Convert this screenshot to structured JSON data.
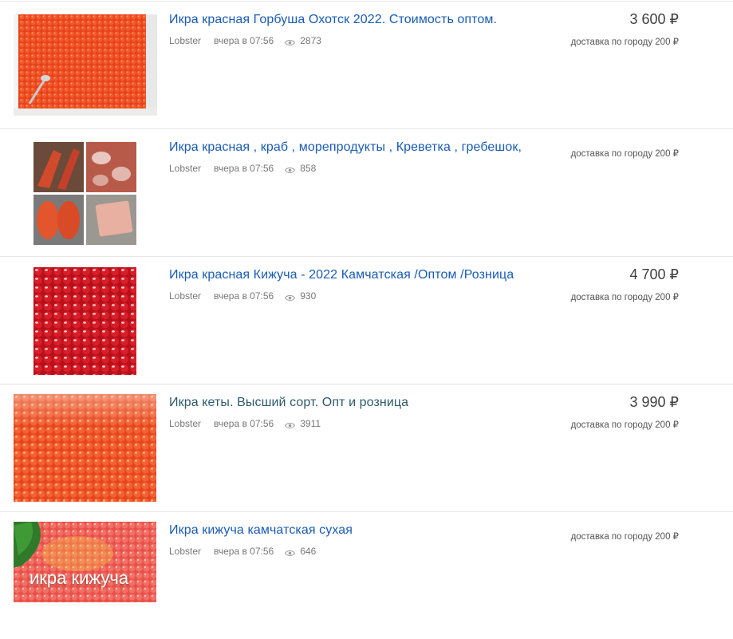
{
  "listings": [
    {
      "title": "Икра красная Горбуша Охотск 2022. Стоимость оптом.",
      "seller": "Lobster",
      "time": "вчера в 07:56",
      "views": "2873",
      "price": "3 600 ₽",
      "delivery": "доставка по городу 200 ₽",
      "image": "red-caviar-tray-photo"
    },
    {
      "title": "Икра красная , краб , морепродукты , Креветка , гребешок,",
      "seller": "Lobster",
      "time": "вчера в 07:56",
      "views": "858",
      "price": "",
      "delivery": "доставка по городу 200 ₽",
      "image": "seafood-collage-photo"
    },
    {
      "title": "Икра красная Кижуча - 2022 Камчатская /Оптом /Розница",
      "seller": "Lobster",
      "time": "вчера в 07:56",
      "views": "930",
      "price": "4 700 ₽",
      "delivery": "доставка по городу 200 ₽",
      "image": "coho-caviar-closeup-photo"
    },
    {
      "title": "Икра кеты. Высший сорт. Опт и розница",
      "seller": "Lobster",
      "time": "вчера в 07:56",
      "views": "3911",
      "price": "3 990 ₽",
      "delivery": "доставка по городу 200 ₽",
      "image": "chum-caviar-closeup-photo"
    },
    {
      "title": "Икра кижуча камчатская сухая",
      "seller": "Lobster",
      "time": "вчера в 07:56",
      "views": "646",
      "price": "",
      "delivery": "доставка по городу 200 ₽",
      "image": "coho-caviar-leaf-photo",
      "image_caption": "икра кижуча"
    }
  ],
  "colors": {
    "title_link": "#1a5bb5",
    "title_visited": "#2d5a6b",
    "meta_text": "#777777",
    "price_text": "#404040",
    "divider": "#e6e6e6"
  }
}
